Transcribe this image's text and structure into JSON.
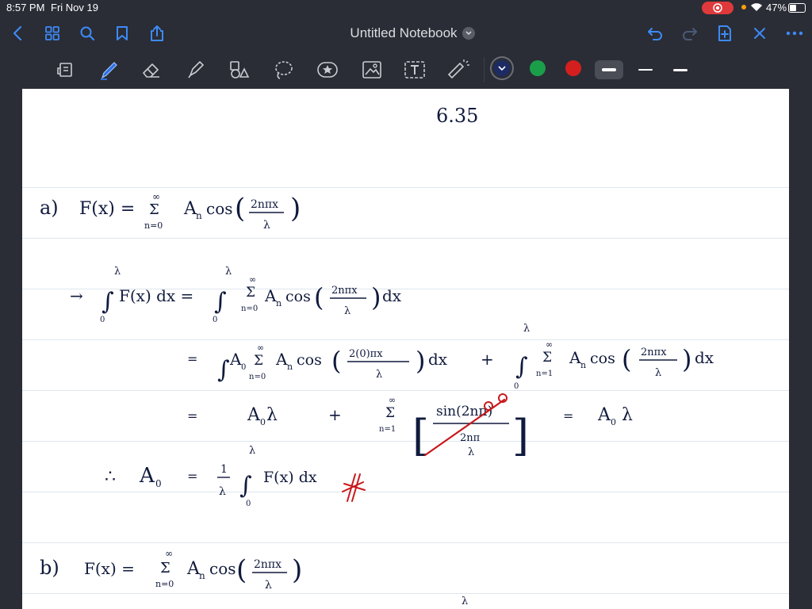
{
  "status_bar": {
    "time": "8:57 PM",
    "date": "Fri Nov 19",
    "battery": "47%",
    "battery_level": 0.47
  },
  "nav": {
    "title": "Untitled Notebook",
    "icons": [
      "back-icon",
      "grid-icon",
      "search-icon",
      "bookmark-icon",
      "share-icon",
      "undo-icon",
      "redo-icon",
      "add-page-icon",
      "close-icon",
      "more-icon"
    ]
  },
  "toolbar": {
    "tools": [
      "page-tool",
      "pen-tool",
      "eraser-tool",
      "highlighter-tool",
      "shapes-tool",
      "lasso-tool",
      "stamp-tool",
      "image-tool",
      "text-tool",
      "laser-pointer-tool"
    ],
    "colors": [
      "#1d2b64",
      "#1a9e4a",
      "#d51f1f"
    ],
    "selected_color": "#1d2b64",
    "stroke_sizes": [
      "thick",
      "thin",
      "medium"
    ]
  },
  "note": {
    "heading": "6.35",
    "part_a": {
      "label": "a)",
      "eq1": "F(x) = Σ A_n cos(2nπx/λ)",
      "eq1_lhs": "F(x) =",
      "eq1_sum_top": "∞",
      "eq1_sum_bottom": "n=0",
      "eq1_term": "A",
      "eq1_sub": "n",
      "eq1_cos": "cos",
      "eq1_num": "2nπx",
      "eq1_den": "λ",
      "int_arrow": "→",
      "int_upper": "λ",
      "int_lower": "0",
      "int_lhs": "F(x) dx =",
      "int_rhs_term": "A",
      "int_rhs_sub": "n",
      "int_rhs_cos": "cos",
      "int_rhs_num": "2nπx",
      "int_rhs_den": "λ",
      "int_rhs_dx": "dx",
      "line2_eq": "=",
      "line2_a0": "A",
      "line2_a0_sub": "0",
      "line2_n0": "n=0",
      "line2_num": "2(0)πx",
      "line2_den": "λ",
      "line2_plus": "+",
      "line2_n1": "n=1",
      "line3_eq": "=",
      "line3_a0lambda": "A",
      "line3_a0lambda_sub": "0",
      "line3_lambda": "λ",
      "line3_plus": "+",
      "line3_sin_num": "sin(2nπ)",
      "line3_sin_den_top": "2nπ",
      "line3_sin_den_bottom": "λ",
      "line3_result_eq": "=",
      "line3_result": "A",
      "line3_result_sub": "0",
      "line3_result_lambda": "λ",
      "therefore": "∴",
      "a0_label": "A",
      "a0_sub": "0",
      "a0_eq": "=",
      "a0_frac_num": "1",
      "a0_frac_den": "λ",
      "a0_int_body": "F(x) dx"
    },
    "part_b": {
      "label": "b)",
      "lhs": "F(x) =",
      "sum_top": "∞",
      "sum_bottom": "n=0",
      "term": "A",
      "sub": "n",
      "cos": "cos",
      "num": "2nπx",
      "den": "λ",
      "bottom_lambda": "λ"
    }
  }
}
